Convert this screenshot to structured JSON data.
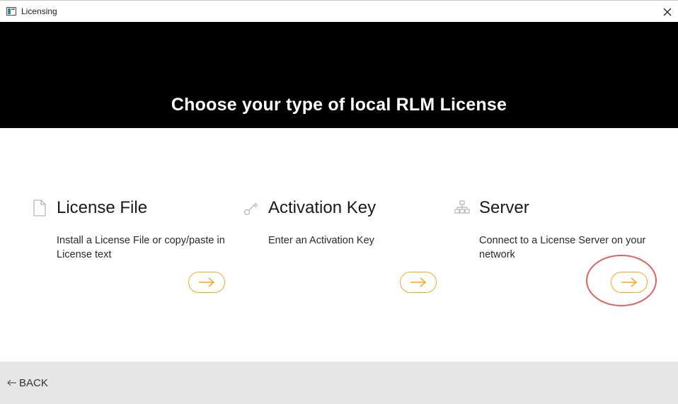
{
  "window": {
    "title": "Licensing"
  },
  "hero": {
    "title": "Choose your type of local RLM License"
  },
  "options": [
    {
      "icon": "document-icon",
      "title": "License File",
      "description": "Install a License File or copy/paste in License text"
    },
    {
      "icon": "key-icon",
      "title": "Activation Key",
      "description": "Enter an Activation Key"
    },
    {
      "icon": "network-icon",
      "title": "Server",
      "description": "Connect to a License Server on your network"
    }
  ],
  "footer": {
    "back_label": "BACK"
  },
  "colors": {
    "accent": "#f2a922",
    "hero_background": "#000000",
    "footer_background": "#e6e6e6",
    "annotation": "#e06060"
  }
}
